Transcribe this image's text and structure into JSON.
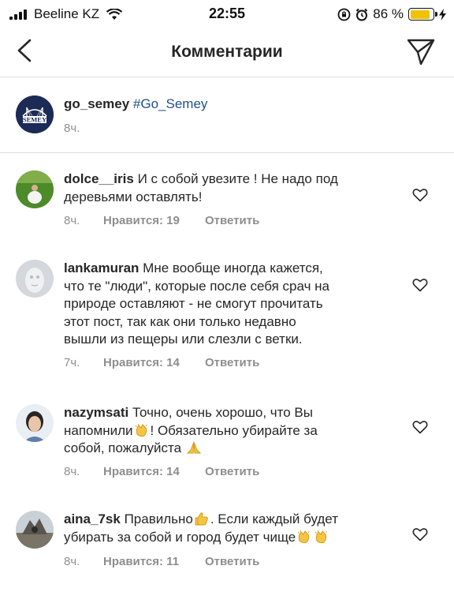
{
  "status_bar": {
    "carrier": "Beeline KZ",
    "time": "22:55",
    "battery_percent": "86 %",
    "battery_level": 0.86
  },
  "nav": {
    "title": "Комментарии",
    "back_icon": "chevron-left-icon",
    "send_icon": "paper-plane-icon"
  },
  "caption": {
    "username": "go_semey",
    "hashtag": "#Go_Semey",
    "time": "8ч.",
    "avatar_text": "SEMEY"
  },
  "comments": [
    {
      "username": "dolce__iris",
      "lines": [
        "И с собой увезите ! Не надо под",
        "деревьями оставлять!"
      ],
      "time": "8ч.",
      "likes": "Нравится: 19",
      "reply": "Ответить"
    },
    {
      "username": "lankamuran",
      "lines": [
        "Мне вообще иногда кажется,",
        "что те \"люди\", которые после себя срач на",
        "природе оставляют - не смогут прочитать",
        "этот пост, так как они только недавно",
        "вышли из пещеры или слезли с ветки."
      ],
      "time": "7ч.",
      "likes": "Нравится: 14",
      "reply": "Ответить"
    },
    {
      "username": "nazymsati",
      "line1_text": "Точно, очень хорошо, что Вы",
      "line2_before": "напомнили",
      "line2_after": "! Обязательно убирайте за",
      "line3_text": "собой, пожалуйста",
      "time": "8ч.",
      "likes": "Нравится: 14",
      "reply": "Ответить"
    },
    {
      "username": "aina_7sk",
      "line1_before": "Правильно",
      "line1_after": ". Если каждый будет",
      "line2_text": "убирать за собой и город будет чище",
      "time": "8ч.",
      "likes": "Нравится: 11",
      "reply": "Ответить"
    }
  ]
}
